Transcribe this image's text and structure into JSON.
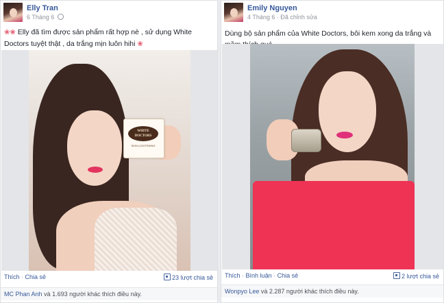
{
  "posts": [
    {
      "author": "Elly Tran",
      "date": "6 Tháng 6",
      "edited": "",
      "text_flowers_left": "❀❀",
      "text": "Elly đã tìm được sản phẩm rất hợp nè , sử dụng White Doctors tuyệt thật , da trắng mịn luôn hihi",
      "text_flower_right": "❀",
      "product": {
        "brand_line1": "WHITE",
        "brand_line2": "DOCTORS",
        "sub": "SKIN LIGHTENING"
      },
      "actions": {
        "like": "Thích",
        "comment": "",
        "share": "Chia sẻ",
        "share_count": "23 lượt chia sẻ"
      },
      "likes_name": "MC Phan Anh",
      "likes_rest": "và 1.693 người khác thích điều này."
    },
    {
      "author": "Emily Nguyen",
      "date": "4 Tháng 6",
      "edited": "Đã chỉnh sửa",
      "text": "Dùng bộ sản phẩm của White Doctors, bôi kem xong da trắng và mềm thích quá",
      "actions": {
        "like": "Thích",
        "comment": "Bình luận",
        "share": "Chia sẻ",
        "share_count": "2 lượt chia sẻ"
      },
      "likes_name": "Wonpyo Lee",
      "likes_rest": "và 2.287 người khác thích điều này."
    }
  ],
  "colors": {
    "link": "#365899",
    "meta": "#90949c",
    "lip_pink": "#e2345e",
    "top_red": "#ee3355"
  }
}
